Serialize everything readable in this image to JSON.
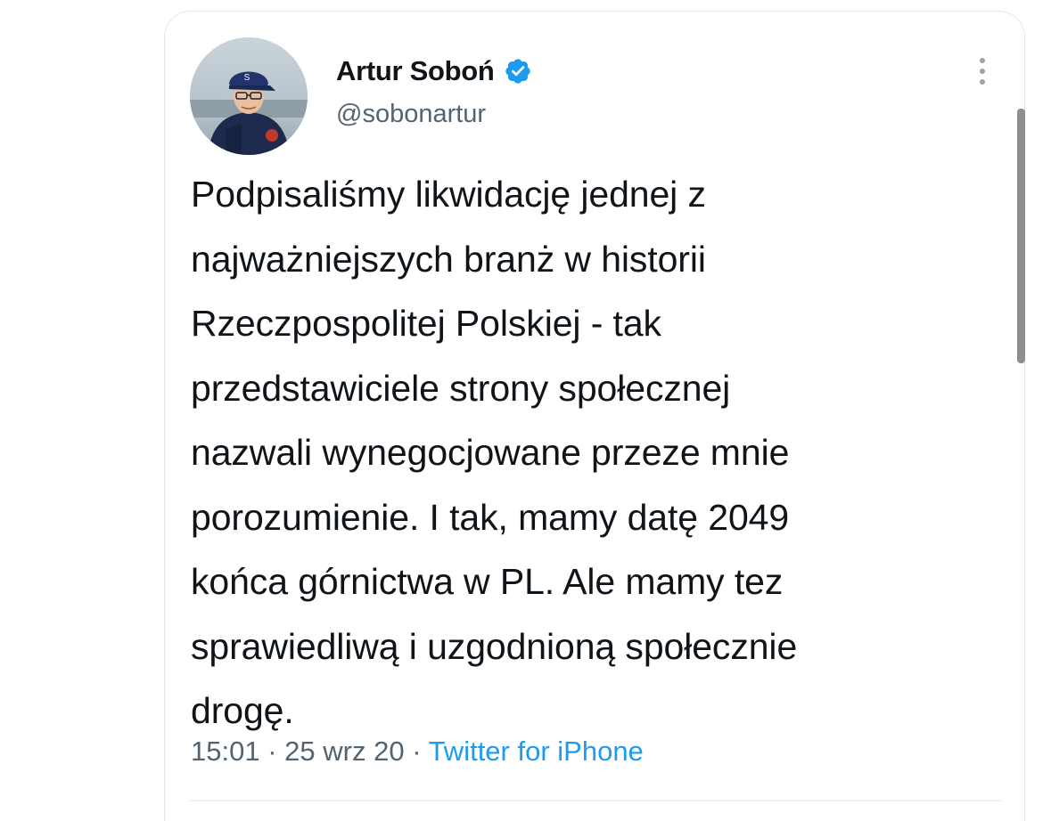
{
  "tweet": {
    "author": {
      "display_name": "Artur Soboń",
      "handle": "@sobonartur",
      "verified": true,
      "verified_icon": "verified-badge-icon",
      "avatar_icon": "avatar"
    },
    "text": "Podpisaliśmy likwidację jednej z\nnajważniejszych branż w historii\nRzeczpospolitej Polskiej - tak\nprzedstawiciele strony społecznej\nnazwali wynegocjowane przeze mnie\nporozumienie. I tak, mamy datę 2049\nkońca górnictwa w PL. Ale mamy tez\nsprawiedliwą i uzgodnioną społecznie\ndrogę.",
    "time": "15:01",
    "separator": "·",
    "date": "25 wrz 20",
    "source": "Twitter for iPhone",
    "more_icon": "more-vertical-icon"
  },
  "colors": {
    "accent": "#1d9bf0",
    "text_primary": "#0f1419",
    "text_secondary": "#536471",
    "border": "#e6e9ec"
  }
}
